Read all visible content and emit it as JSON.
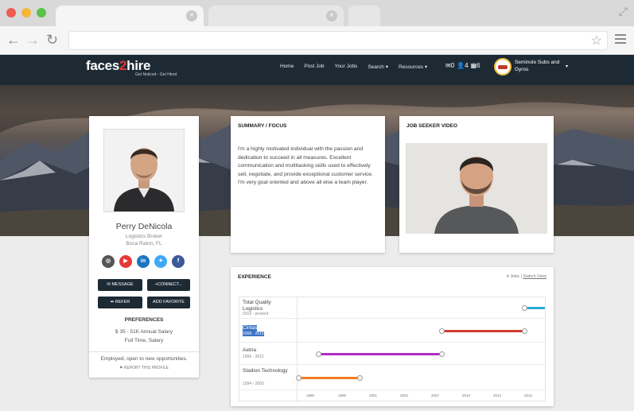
{
  "browser": {
    "tab_close_glyph": "×",
    "star_glyph": "☆"
  },
  "site": {
    "logo_text_a": "faces",
    "logo_text_b": "2",
    "logo_text_c": "hire",
    "tagline": "Get Noticed - Get Hired",
    "nav": [
      "Home",
      "Post Job",
      "Your Jobs",
      "Search ▾",
      "Resources ▾"
    ],
    "nav_counts": [
      "✉0",
      "👤4",
      "▦6"
    ],
    "user_name": "Seminole Subs and Gyros",
    "user_caret": "▾"
  },
  "profile": {
    "name": "Perry DeNicola",
    "title": "Logistics Broker",
    "location": "Boca Raton, FL",
    "socials": [
      {
        "name": "instagram",
        "glyph": "◎",
        "color": "#555555"
      },
      {
        "name": "youtube",
        "glyph": "▶",
        "color": "#e53935"
      },
      {
        "name": "linkedin",
        "glyph": "in",
        "color": "#1e73be"
      },
      {
        "name": "twitter",
        "glyph": "✦",
        "color": "#3fa9f5"
      },
      {
        "name": "facebook",
        "glyph": "f",
        "color": "#3b5998"
      }
    ],
    "buttons": {
      "message": "✉ MESSAGE",
      "connect": "+CONNECT...",
      "refer": "➦ REFER",
      "favorite": "ADD FAVORITE"
    },
    "preferences_title": "PREFERENCES",
    "salary": "$ 35 - 51K Annual Salary",
    "schedule": "Full Time, Salary",
    "employment_status": "Employed, open to new opportunities.",
    "report": "⚑ REPORT THIS PROFILE"
  },
  "summary": {
    "title": "SUMMARY / FOCUS",
    "text": "I'm a highly motivated individual with the passion and dedication to succeed in all measures. Excellent communication and multitasking skills used to effectively sell, negotiate, and provide exceptional customer service. I'm very goal oriented and above all else a team player."
  },
  "video": {
    "title": "JOB SEEKER VIDEO"
  },
  "experience": {
    "title": "EXPERIENCE",
    "jobs_count": "4 Jobs",
    "switch_view": "Switch View",
    "jobs": [
      {
        "company": "Total Quality Logistics",
        "dates": "2016 - present",
        "start": 2016,
        "end": 2018,
        "color": "#29a8d8"
      },
      {
        "company": "Cintas",
        "dates": "2008 - 2015",
        "start": 2008,
        "end": 2016,
        "color": "#d23a2f"
      },
      {
        "company": "Aetna",
        "dates": "1996 - 2012",
        "start": 1996,
        "end": 2008,
        "color": "#b22bc4"
      },
      {
        "company": "Stadion Technology",
        "dates": "1994 - 2000",
        "start": 1994,
        "end": 2000,
        "color": "#f07c22"
      }
    ],
    "ticks": [
      "1996",
      "1998",
      "2001",
      "2004",
      "2007",
      "2010",
      "2013",
      "2016"
    ]
  }
}
